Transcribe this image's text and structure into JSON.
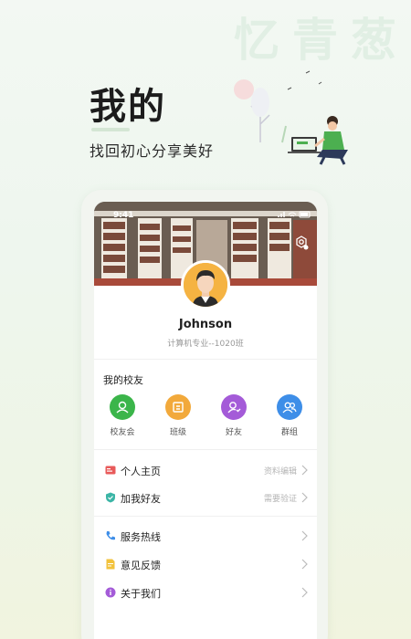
{
  "watermark": "忆青葱",
  "hero": {
    "title": "我的",
    "subtitle": "找回初心分享美好"
  },
  "status_bar": {
    "time": "9:41"
  },
  "profile": {
    "name": "Johnson",
    "major": "计算机专业--1020班"
  },
  "alumni": {
    "title": "我的校友",
    "shortcuts": [
      {
        "label": "校友会",
        "icon": "alumni-association-icon",
        "color": "#3bb54a"
      },
      {
        "label": "班级",
        "icon": "class-icon",
        "color": "#f2a93b"
      },
      {
        "label": "好友",
        "icon": "friend-icon",
        "color": "#a45bd8"
      },
      {
        "label": "群组",
        "icon": "group-icon",
        "color": "#3e8ee8"
      }
    ]
  },
  "menu": {
    "homepage": {
      "label": "个人主页",
      "hint": "资料编辑",
      "icon": "id-card-icon",
      "color": "#e85a5a"
    },
    "add_friend": {
      "label": "加我好友",
      "hint": "需要验证",
      "icon": "shield-check-icon",
      "color": "#3bb5a6"
    },
    "hotline": {
      "label": "服务热线",
      "icon": "phone-icon",
      "color": "#3e8ee8"
    },
    "feedback": {
      "label": "意见反馈",
      "icon": "feedback-icon",
      "color": "#f2c23b"
    },
    "about": {
      "label": "关于我们",
      "icon": "info-icon",
      "color": "#a45bd8"
    }
  }
}
